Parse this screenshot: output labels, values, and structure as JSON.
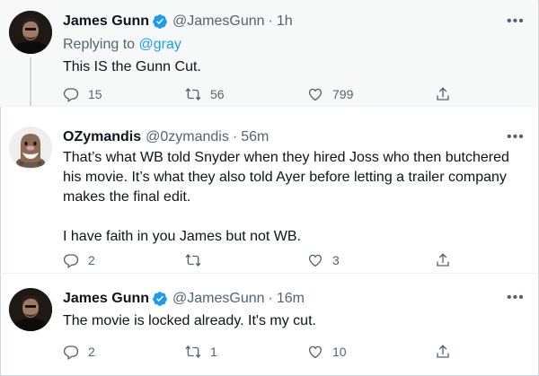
{
  "tweets": [
    {
      "name": "James Gunn",
      "handle": "@JamesGunn",
      "time": "1h",
      "replying_prefix": "Replying to ",
      "replying_to": "@gray",
      "text": "This IS the Gunn Cut.",
      "stats": {
        "replies": "15",
        "retweets": "56",
        "likes": "799"
      }
    },
    {
      "name": "OZymandis",
      "handle": "@0zymandis",
      "time": "56m",
      "paragraphs": [
        "That’s what WB told Snyder when they hired Joss who then butchered his movie. It’s what they also told Ayer before letting a trailer company makes the final edit.",
        "I have faith in you James but not WB."
      ],
      "stats": {
        "replies": "2",
        "retweets": "",
        "likes": "3"
      }
    },
    {
      "name": "James Gunn",
      "handle": "@JamesGunn",
      "time": "16m",
      "text": "The movie is locked already. It's my cut.",
      "stats": {
        "replies": "2",
        "retweets": "1",
        "likes": "10"
      }
    }
  ],
  "ui": {
    "dot": "·",
    "more": "•••"
  },
  "colors": {
    "verified": "#1d9bf0",
    "link": "#1d9bf0",
    "muted": "#536471",
    "text": "#0f1419"
  }
}
